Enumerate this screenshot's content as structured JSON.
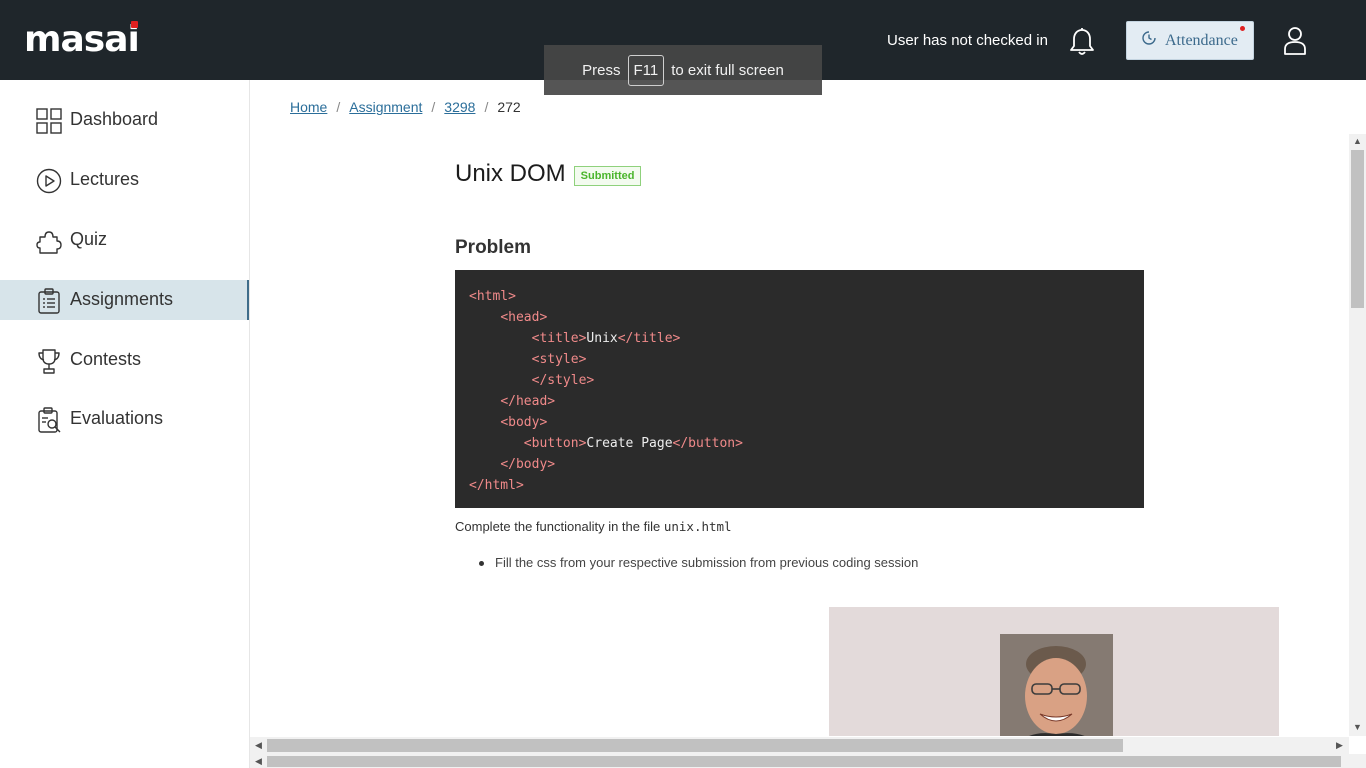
{
  "header": {
    "logo_text_prefix": "mas",
    "logo_text_suffix": "i",
    "logo_text_a": "a",
    "checkin_status": "User has not checked in",
    "attendance_label": "Attendance",
    "colors": {
      "background": "#1f262b",
      "accent_red": "#e02020"
    }
  },
  "fullscreen_toast": {
    "before": "Press",
    "key": "F11",
    "after": "to exit full screen"
  },
  "sidebar": {
    "items": [
      {
        "label": "Dashboard",
        "icon": "grid-icon",
        "active": false
      },
      {
        "label": "Lectures",
        "icon": "play-circle-icon",
        "active": false
      },
      {
        "label": "Quiz",
        "icon": "puzzle-icon",
        "active": false
      },
      {
        "label": "Assignments",
        "icon": "clipboard-icon",
        "active": true
      },
      {
        "label": "Contests",
        "icon": "trophy-icon",
        "active": false
      },
      {
        "label": "Evaluations",
        "icon": "evaluation-icon",
        "active": false
      }
    ]
  },
  "breadcrumb": {
    "items": [
      "Home",
      "Assignment",
      "3298"
    ],
    "current": "272",
    "separator": "/"
  },
  "assignment": {
    "title": "Unix DOM",
    "status_badge": "Submitted",
    "section_title": "Problem",
    "code_lines": [
      [
        {
          "t": "tag",
          "v": "<html>"
        }
      ],
      [
        {
          "t": "txt",
          "v": "    "
        },
        {
          "t": "tag",
          "v": "<head>"
        }
      ],
      [
        {
          "t": "txt",
          "v": "        "
        },
        {
          "t": "tag",
          "v": "<title>"
        },
        {
          "t": "txt",
          "v": "Unix"
        },
        {
          "t": "tag",
          "v": "</title>"
        }
      ],
      [
        {
          "t": "txt",
          "v": "        "
        },
        {
          "t": "tag",
          "v": "<style>"
        }
      ],
      [
        {
          "t": "txt",
          "v": "        "
        },
        {
          "t": "tag",
          "v": "</style>"
        }
      ],
      [
        {
          "t": "txt",
          "v": "    "
        },
        {
          "t": "tag",
          "v": "</head>"
        }
      ],
      [
        {
          "t": "txt",
          "v": "    "
        },
        {
          "t": "tag",
          "v": "<body>"
        }
      ],
      [
        {
          "t": "txt",
          "v": "       "
        },
        {
          "t": "tag",
          "v": "<button>"
        },
        {
          "t": "txt",
          "v": "Create Page"
        },
        {
          "t": "tag",
          "v": "</button>"
        }
      ],
      [
        {
          "t": "txt",
          "v": "    "
        },
        {
          "t": "tag",
          "v": "</body>"
        }
      ],
      [
        {
          "t": "tag",
          "v": "</html>"
        }
      ]
    ],
    "description_prefix": "Complete the functionality in the file ",
    "description_file": "unix.html",
    "bullets": [
      "Fill the css from your respective submission from previous coding session"
    ]
  }
}
